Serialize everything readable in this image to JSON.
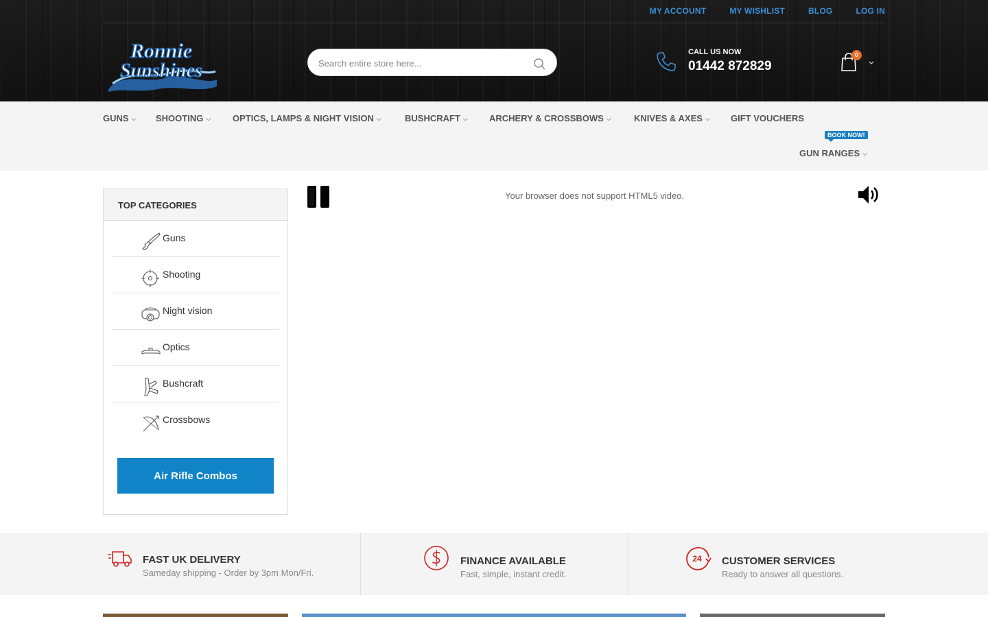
{
  "toplinks": {
    "account": "MY ACCOUNT",
    "wishlist": "MY WISHLIST",
    "blog": "BLOG",
    "login": "LOG IN"
  },
  "logo": {
    "text_line1": "Ronnie",
    "text_line2": "Sunshines"
  },
  "search": {
    "placeholder": "Search entire store here..."
  },
  "contact": {
    "label": "CALL US NOW",
    "number": "01442 872829"
  },
  "cart": {
    "count": "0"
  },
  "nav": {
    "items": [
      "GUNS",
      "SHOOTING",
      "OPTICS, LAMPS & NIGHT VISION",
      "BUSHCRAFT",
      "ARCHERY & CROSSBOWS",
      "KNIVES & AXES",
      "GIFT VOUCHERS"
    ],
    "badge": "BOOK NOW!",
    "gun_ranges": "GUN RANGES"
  },
  "sidebar": {
    "title": "TOP CATEGORIES",
    "items": [
      {
        "label": "Guns",
        "icon": "rifle-icon"
      },
      {
        "label": "Shooting",
        "icon": "target-icon"
      },
      {
        "label": "Night vision",
        "icon": "night-vision-icon"
      },
      {
        "label": "Optics",
        "icon": "scope-icon"
      },
      {
        "label": "Bushcraft",
        "icon": "multitool-icon"
      },
      {
        "label": "Crossbows",
        "icon": "crossbow-icon"
      }
    ],
    "button": "Air Rifle Combos"
  },
  "video": {
    "message": "Your browser does not support HTML5 video."
  },
  "services": [
    {
      "title": "FAST UK DELIVERY",
      "sub": "Sameday shipping - Order by 3pm Mon/Fri.",
      "icon": "delivery-truck-icon"
    },
    {
      "title": "FINANCE AVAILABLE",
      "sub": "Fast, simple, instant credit.",
      "icon": "dollar-icon"
    },
    {
      "title": "CUSTOMER SERVICES",
      "sub": "Ready to answer all questions.",
      "icon": "24-hour-icon"
    }
  ],
  "colors": {
    "accent": "#1184c8",
    "link": "#3b8fd6",
    "badge": "#e8702a",
    "service_icon": "#d42020"
  }
}
